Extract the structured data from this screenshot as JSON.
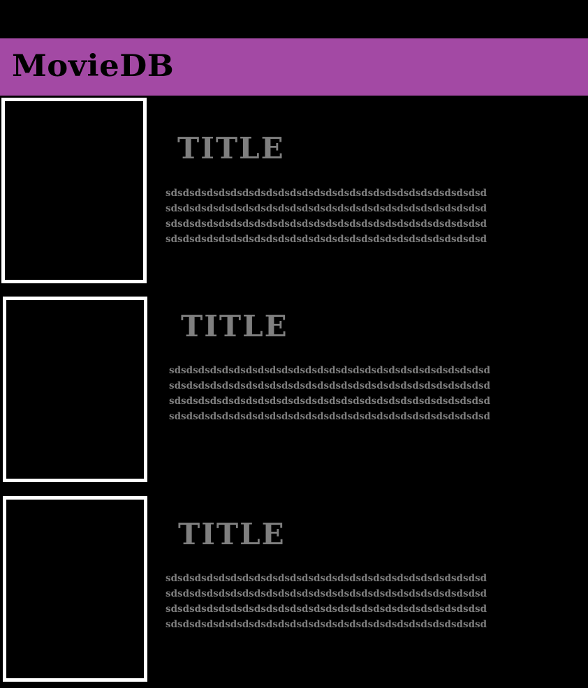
{
  "app": {
    "brand": "MovieDB"
  },
  "movies": [
    {
      "title": "TITLE",
      "description_lines": [
        "sdsdsdsdsdsdsdsdsdsdsdsdsdsdsdsdsdsdsdsdsdsdsdsdsdsdsd",
        "sdsdsdsdsdsdsdsdsdsdsdsdsdsdsdsdsdsdsdsdsdsdsdsdsdsdsd",
        "sdsdsdsdsdsdsdsdsdsdsdsdsdsdsdsdsdsdsdsdsdsdsdsdsdsdsd",
        "sdsdsdsdsdsdsdsdsdsdsdsdsdsdsdsdsdsdsdsdsdsdsdsdsdsdsd"
      ]
    },
    {
      "title": "TITLE",
      "description_lines": [
        "sdsdsdsdsdsdsdsdsdsdsdsdsdsdsdsdsdsdsdsdsdsdsdsdsdsdsd",
        "sdsdsdsdsdsdsdsdsdsdsdsdsdsdsdsdsdsdsdsdsdsdsdsdsdsdsd",
        "sdsdsdsdsdsdsdsdsdsdsdsdsdsdsdsdsdsdsdsdsdsdsdsdsdsdsd",
        "sdsdsdsdsdsdsdsdsdsdsdsdsdsdsdsdsdsdsdsdsdsdsdsdsdsdsd"
      ]
    },
    {
      "title": "TITLE",
      "description_lines": [
        "sdsdsdsdsdsdsdsdsdsdsdsdsdsdsdsdsdsdsdsdsdsdsdsdsdsdsd",
        "sdsdsdsdsdsdsdsdsdsdsdsdsdsdsdsdsdsdsdsdsdsdsdsdsdsdsd",
        "sdsdsdsdsdsdsdsdsdsdsdsdsdsdsdsdsdsdsdsdsdsdsdsdsdsdsd",
        "sdsdsdsdsdsdsdsdsdsdsdsdsdsdsdsdsdsdsdsdsdsdsdsdsdsdsd"
      ]
    }
  ],
  "colors": {
    "header_bg": "#a349a4",
    "page_bg": "#000000",
    "title_text": "#7f7f7f",
    "body_text": "#7f7f7f",
    "poster_border": "#ffffff"
  }
}
